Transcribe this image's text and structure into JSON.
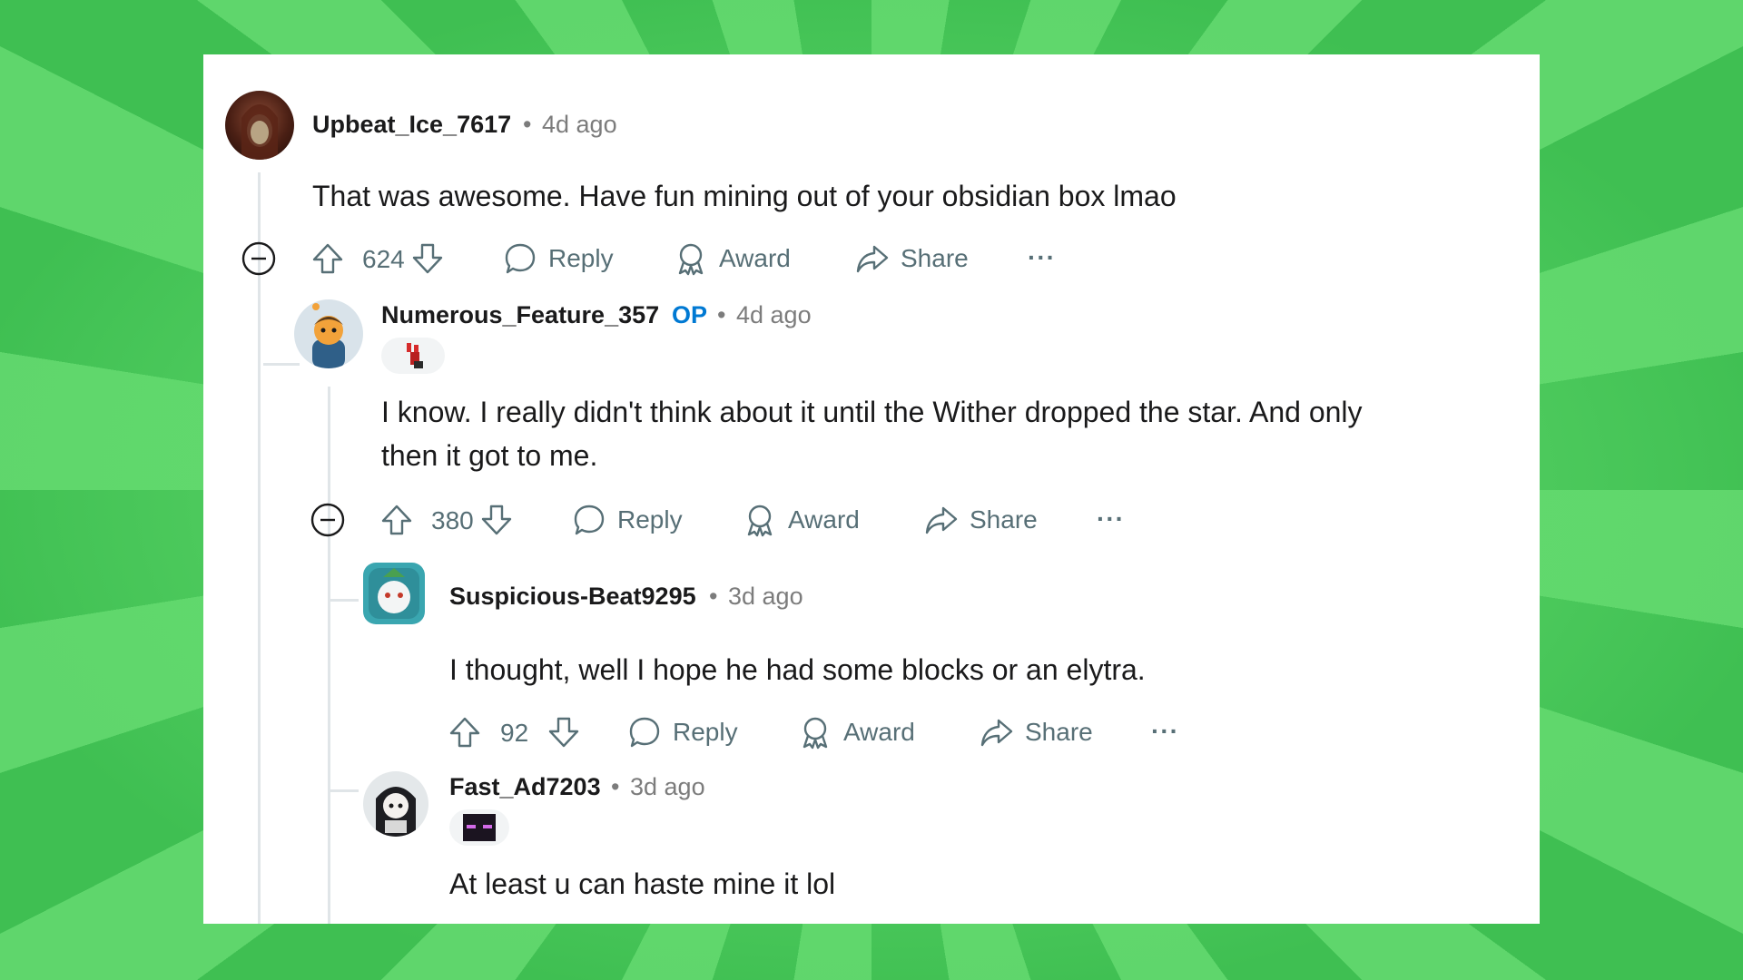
{
  "comments": [
    {
      "username": "Upbeat_Ice_7617",
      "time": "4d ago",
      "text": "That was awesome. Have fun mining out of your obsidian box lmao",
      "votes": "624",
      "reply": "Reply",
      "award": "Award",
      "share": "Share",
      "more": "···",
      "avatar_color": "#4a1f14"
    },
    {
      "username": "Numerous_Feature_357",
      "op_badge": "OP",
      "time": "4d ago",
      "text_line1": "I know. I really didn't think about it until the Wither dropped the star. And only",
      "text_line2": "then it got to me.",
      "votes": "380",
      "reply": "Reply",
      "award": "Award",
      "share": "Share",
      "more": "···",
      "avatar_color": "#d9e3ea"
    },
    {
      "username": "Suspicious-Beat9295",
      "time": "3d ago",
      "text": "I thought, well I hope he had some blocks or an elytra.",
      "votes": "92",
      "reply": "Reply",
      "award": "Award",
      "share": "Share",
      "more": "···",
      "avatar_color": "#3aa6b0"
    },
    {
      "username": "Fast_Ad7203",
      "time": "3d ago",
      "text": "At least u can haste mine it lol",
      "avatar_color": "#e4e8ea"
    }
  ],
  "separator": "•",
  "colors": {
    "op_blue": "#0079d3",
    "meta_gray": "#7c7c7c",
    "action_gray": "#576f76",
    "background_green": "#4ccc5e"
  }
}
